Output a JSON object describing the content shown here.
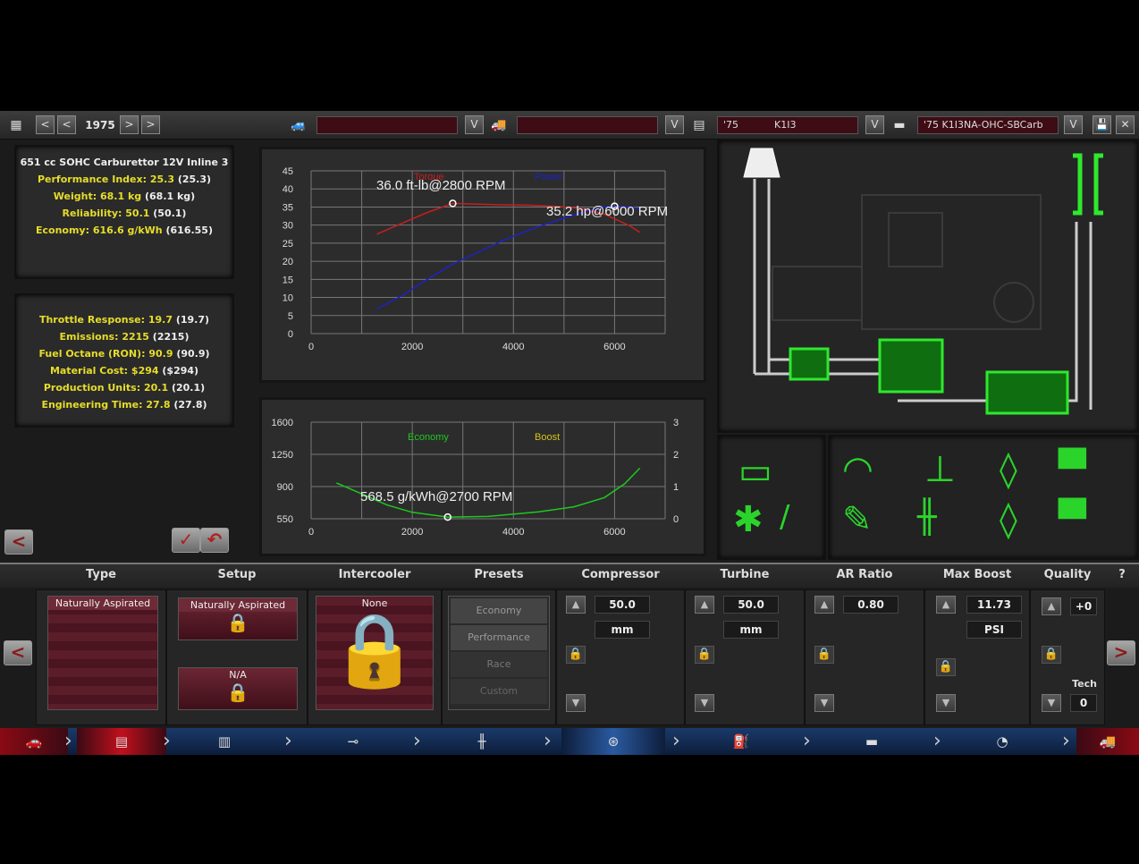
{
  "topbar": {
    "year": "1975",
    "car_model": "",
    "car_trim": "",
    "engine_family_year": "'75",
    "engine_family_name": "K1I3",
    "engine_variant": "'75 K1I3NA-OHC-SBCarb",
    "prev_year_fast": "<",
    "prev_year": "<",
    "next_year": ">",
    "next_year_fast": ">",
    "dropdown_glyph": "V",
    "close_glyph": "✕",
    "save_glyph": "💾"
  },
  "stats_primary": {
    "engine_desc": "651 cc SOHC Carburettor 12V Inline 3",
    "performance_index": {
      "label": "Performance Index:",
      "value": "25.3",
      "prev": "(25.3)"
    },
    "weight": {
      "label": "Weight:",
      "value": "68.1 kg",
      "prev": "(68.1 kg)"
    },
    "reliability": {
      "label": "Reliability:",
      "value": "50.1",
      "prev": "(50.1)"
    },
    "economy": {
      "label": "Economy:",
      "value": "616.6 g/kWh",
      "prev": "(616.55)"
    }
  },
  "stats_secondary": {
    "throttle": {
      "label": "Throttle Response:",
      "value": "19.7",
      "prev": "(19.7)"
    },
    "emissions": {
      "label": "Emissions:",
      "value": "2215",
      "prev": "(2215)"
    },
    "octane": {
      "label": "Fuel Octane (RON):",
      "value": "90.9",
      "prev": "(90.9)"
    },
    "material": {
      "label": "Material Cost:",
      "value": "$294",
      "prev": "($294)"
    },
    "production": {
      "label": "Production Units:",
      "value": "20.1",
      "prev": "(20.1)"
    },
    "engineering": {
      "label": "Engineering Time:",
      "value": "27.8",
      "prev": "(27.8)"
    }
  },
  "chart_data": [
    {
      "type": "line",
      "legend": [
        "Torque",
        "Power"
      ],
      "annotations": [
        "36.0 ft-lb@2800 RPM",
        "35.2 hp@6000 RPM"
      ],
      "ylim": [
        0,
        45
      ],
      "y_ticks": [
        "45",
        "40",
        "35",
        "30",
        "25",
        "20",
        "15",
        "10",
        "5",
        "0"
      ],
      "xlim": [
        0,
        7000
      ],
      "x_ticks": [
        "0",
        "2000",
        "4000",
        "6000"
      ],
      "colors": {
        "Torque": "#c81e1e",
        "Power": "#1e22c8"
      },
      "series": [
        {
          "name": "Torque",
          "x": [
            1300,
            1800,
            2300,
            2800,
            3300,
            3800,
            4300,
            4800,
            5300,
            5800,
            6300,
            6500
          ],
          "values": [
            27.5,
            30.5,
            33.5,
            36.0,
            35.8,
            35.6,
            35.5,
            35.2,
            34.7,
            33.0,
            29.8,
            28.0
          ]
        },
        {
          "name": "Power",
          "x": [
            1300,
            1800,
            2300,
            2800,
            3300,
            3800,
            4300,
            4800,
            5300,
            5800,
            6000,
            6300,
            6500
          ],
          "values": [
            6.8,
            10.5,
            15.0,
            19.2,
            22.5,
            25.8,
            28.6,
            31.0,
            33.2,
            35.0,
            35.2,
            35.0,
            34.5
          ]
        }
      ]
    },
    {
      "type": "line",
      "legend": [
        "Economy",
        "Boost"
      ],
      "annotations": [
        "568.5 g/kWh@2700 RPM"
      ],
      "ylim": [
        550,
        1600
      ],
      "y_ticks": [
        "1600",
        "1250",
        "900",
        "550"
      ],
      "y2lim": [
        0,
        3
      ],
      "y2_ticks": [
        "3",
        "2",
        "1",
        "0"
      ],
      "xlim": [
        0,
        7000
      ],
      "x_ticks": [
        "0",
        "2000",
        "4000",
        "6000"
      ],
      "colors": {
        "Economy": "#1ec81e",
        "Boost": "#d4c21a"
      },
      "series": [
        {
          "name": "Economy",
          "x": [
            500,
            1000,
            1500,
            2000,
            2700,
            3500,
            4500,
            5200,
            5800,
            6200,
            6500
          ],
          "values": [
            940,
            820,
            700,
            620,
            568,
            575,
            625,
            680,
            780,
            930,
            1100
          ]
        }
      ]
    }
  ],
  "tabs": {
    "type": "Type",
    "setup": "Setup",
    "intercooler": "Intercooler",
    "presets": "Presets",
    "compressor": "Compressor",
    "turbine": "Turbine",
    "ar_ratio": "AR Ratio",
    "max_boost": "Max Boost",
    "quality": "Quality",
    "help": "?"
  },
  "options": {
    "type_selected": "Naturally Aspirated",
    "setup_selected": "Naturally Aspirated",
    "setup_second": "N/A",
    "intercooler": "None",
    "presets": [
      "Economy",
      "Performance",
      "Race",
      "Custom"
    ]
  },
  "fields": {
    "compressor_value": "50.0",
    "compressor_unit": "mm",
    "turbine_value": "50.0",
    "turbine_unit": "mm",
    "ar_value": "0.80",
    "boost_value": "11.73",
    "boost_unit": "PSI",
    "quality_value": "+0",
    "tech_label": "Tech",
    "tech_value": "0"
  },
  "glyphs": {
    "up": "▲",
    "down": "▼",
    "lock": "🔒",
    "left": "<",
    "right": ">",
    "apply": "✓",
    "undo": "↶"
  }
}
